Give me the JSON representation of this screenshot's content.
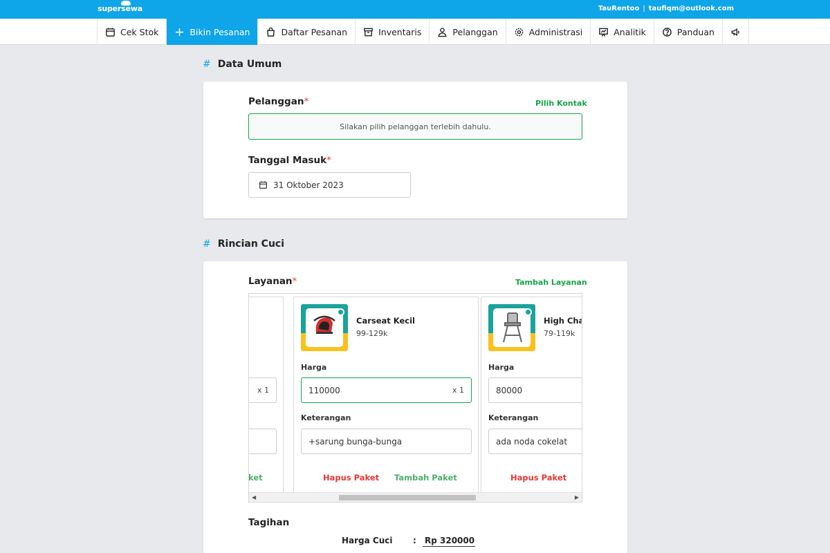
{
  "app": {
    "brand": "supersewa",
    "store": "TauRentoo",
    "separator": "|",
    "email": "taufiqm@outlook.com"
  },
  "nav": {
    "items": [
      {
        "label": "Cek Stok",
        "icon": "calendar-icon"
      },
      {
        "label": "Bikin Pesanan",
        "icon": "plus-icon",
        "active": true
      },
      {
        "label": "Daftar Pesanan",
        "icon": "bag-icon"
      },
      {
        "label": "Inventaris",
        "icon": "archive-icon"
      },
      {
        "label": "Pelanggan",
        "icon": "user-icon"
      },
      {
        "label": "Administrasi",
        "icon": "gear-icon"
      },
      {
        "label": "Analitik",
        "icon": "presentation-chart-icon"
      },
      {
        "label": "Panduan",
        "icon": "help-circle-icon"
      },
      {
        "label": "",
        "icon": "megaphone-icon"
      }
    ]
  },
  "data_umum": {
    "title": "Data Umum",
    "hash": "#",
    "pelanggan_label": "Pelanggan",
    "required_mark": "*",
    "pilih_kontak": "Pilih Kontak",
    "pelanggan_placeholder": "Silakan pilih pelanggan terlebih dahulu.",
    "tanggal_label": "Tanggal Masuk",
    "tanggal_value": "31 Oktober 2023"
  },
  "rincian": {
    "title": "Rincian Cuci",
    "hash": "#",
    "layanan_label": "Layanan",
    "required_mark": "*",
    "tambah_layanan": "Tambah Layanan",
    "partial_card": {
      "qty": "x 1",
      "action": "ket"
    },
    "services": [
      {
        "name": "Carseat Kecil",
        "range": "99-129k",
        "thumb_caption": "Carseat Infant",
        "harga_label": "Harga",
        "harga": "110000",
        "qty": "x 1",
        "keterangan_label": "Keterangan",
        "keterangan": "+sarung bunga-bunga",
        "hapus": "Hapus Paket",
        "tambah": "Tambah Paket"
      },
      {
        "name": "High Chai",
        "range": "79-119k",
        "thumb_caption": "High Chair",
        "harga_label": "Harga",
        "harga": "80000",
        "qty": "",
        "keterangan_label": "Keterangan",
        "keterangan": "ada noda cokelat",
        "hapus": "Hapus Paket",
        "tambah": ""
      }
    ]
  },
  "tagihan": {
    "title": "Tagihan",
    "harga_cuci_label": "Harga Cuci",
    "colon": ":",
    "harga_cuci_value": "Rp  320000"
  },
  "colors": {
    "primary": "#0ea5e9",
    "success": "#16a34a",
    "danger": "#e53935",
    "background": "#e8e9ec"
  }
}
